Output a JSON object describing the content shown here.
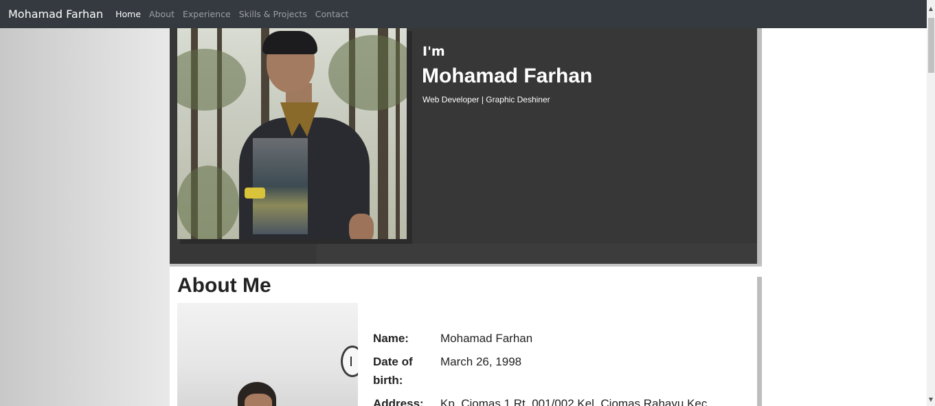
{
  "navbar": {
    "brand": "Mohamad Farhan",
    "links": [
      {
        "label": "Home"
      },
      {
        "label": "About"
      },
      {
        "label": "Experience"
      },
      {
        "label": "Skills & Projects"
      },
      {
        "label": "Contact"
      }
    ]
  },
  "hero": {
    "intro": "I'm",
    "name": "Mohamad Farhan",
    "role": "Web Developer | Graphic Deshiner"
  },
  "about": {
    "title": "About Me",
    "fields": [
      {
        "label": "Name:",
        "value": "Mohamad Farhan"
      },
      {
        "label": "Date of birth:",
        "value": "March 26, 1998"
      },
      {
        "label": "Address:",
        "value": "Kp. Ciomas 1 Rt. 001/002 Kel. Ciomas Rahayu Kec."
      }
    ]
  },
  "scrollbar": {
    "up_icon": "▲",
    "down_icon": "▼"
  },
  "colors": {
    "navbar": "#343a40",
    "hero_bg": "#373737",
    "text_dark": "#222222"
  }
}
